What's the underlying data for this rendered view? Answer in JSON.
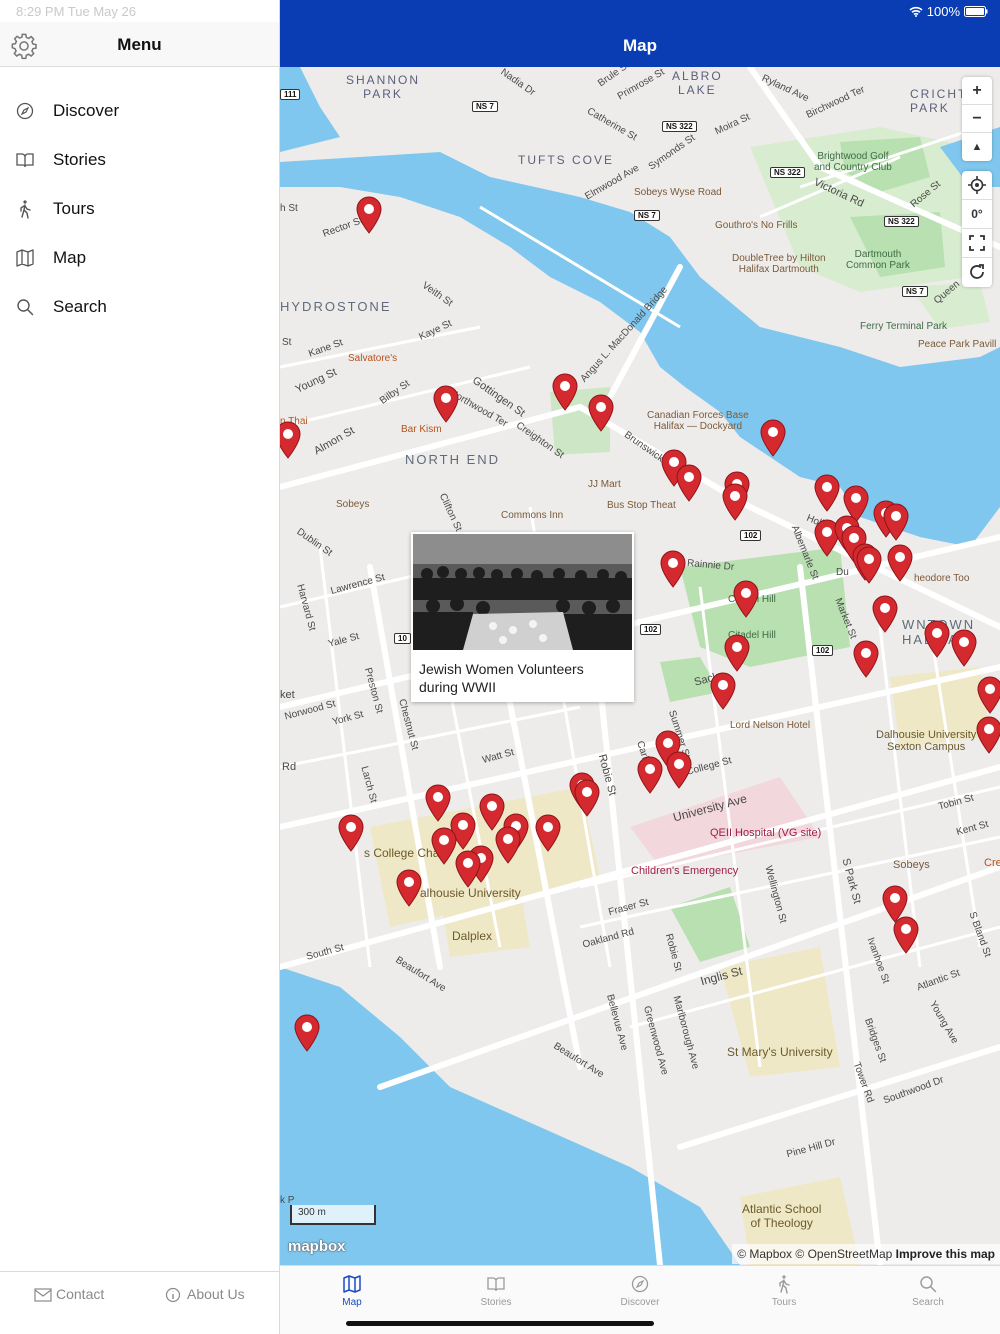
{
  "status": {
    "time": "8:29 PM  Tue May 26",
    "battery": "100%"
  },
  "sidebar": {
    "title": "Menu",
    "items": [
      {
        "label": "Discover",
        "icon": "compass-icon"
      },
      {
        "label": "Stories",
        "icon": "book-icon"
      },
      {
        "label": "Tours",
        "icon": "walking-icon"
      },
      {
        "label": "Map",
        "icon": "map-icon"
      },
      {
        "label": "Search",
        "icon": "search-icon"
      }
    ],
    "footer": {
      "contact": "Contact",
      "about": "About Us"
    }
  },
  "navbar": {
    "title": "Map"
  },
  "map": {
    "popup": {
      "title": "Jewish Women Volunteers during WWII"
    },
    "scale": "300 m",
    "logo": "mapbox",
    "attribution": {
      "mapbox": "© Mapbox",
      "osm": "© OpenStreetMap",
      "improve": "Improve this map"
    },
    "controls": {
      "zoom_in": "+",
      "zoom_out": "−",
      "compass": "▲",
      "bearing": "0°"
    },
    "labels": {
      "shannon_park": "SHANNON\nPARK",
      "albro_lake": "ALBRO\nLAKE",
      "crichton_park": "CRICHT\nPARK",
      "tufts_cove": "TUFTS COVE",
      "hydrostone": "HYDROSTONE",
      "north_end": "NORTH END",
      "downtown_halifax": "WNTOWN\nHALIFAX",
      "brightwood": "Brightwood Golf\nand Country Club",
      "dartmouth_common": "Dartmouth\nCommon Park",
      "sobeys_wyse": "Sobeys Wyse Road",
      "gouthros": "Gouthro's No Frills",
      "doubletree": "DoubleTree by Hilton\nHalifax Dartmouth",
      "ferry_terminal": "Ferry Terminal Park",
      "peace_park": "Peace Park Pavill",
      "cfb": "Canadian Forces Base\nHalifax — Dockyard",
      "salvatores": "Salvatore's",
      "bar_kismet": "Bar Kism",
      "n_thai": "n Thai",
      "jj_mart": "JJ Mart",
      "bus_stop": "Bus Stop Theat",
      "commons_inn": "Commons Inn",
      "sobeys_north": "Sobeys",
      "citadel1": "Citadel Hill",
      "citadel2": "Citadel Hill",
      "theodore": "heodore Too",
      "lord_nelson": "Lord Nelson Hotel",
      "dal_sexton": "Dalhousie University\nSexton Campus",
      "qeii": "QEII Hospital (VG site)",
      "childrens": "Children's Emergency",
      "kings": "s College Cha",
      "dalhousie": "alhousie University",
      "dalplex": "Dalplex",
      "sobeys_south": "Sobeys",
      "st_marys": "St Mary's University",
      "atlantic_school": "Atlantic School\nof Theology",
      "ket": "ket",
      "rd": "Rd",
      "cre": "Cre"
    },
    "streets": {
      "nadia": "Nadia Dr",
      "brule": "Brule St",
      "primrose": "Primrose St",
      "catherine": "Catherine St",
      "ryland": "Ryland Ave",
      "birchwood": "Birchwood Ter",
      "moira": "Moira St",
      "symonds": "Symonds St",
      "elmwood": "Elmwood Ave",
      "victoria": "Victoria Rd",
      "rose": "Rose St",
      "queen": "Queen",
      "rector": "Rector St",
      "veith": "Veith St",
      "kaye": "Kaye St",
      "kane": "Kane St",
      "young": "Young St",
      "bilby": "Bilby St",
      "gottingen": "Gottingen St",
      "northwood": "Northwood Ter",
      "creighton": "Creighton St",
      "almon": "Almon St",
      "angus": "Angus L. MacDonald Bridge",
      "brunswick": "Brunswick St",
      "clifton": "Clifton St",
      "dublin": "Dublin St",
      "lawrence": "Lawrence St",
      "harvard": "Harvard St",
      "yale": "Yale St",
      "preston": "Preston St",
      "chestnut": "Chestnut St",
      "norwood": "Norwood St",
      "york": "York St",
      "larch": "Larch St",
      "watt": "Watt St",
      "robie": "Robie St",
      "robie2": "Robie St",
      "summer": "Summer St",
      "carlton": "Carlton St",
      "college": "College St",
      "university": "University Ave",
      "sackville": "Sackv",
      "rainnie": "Rainnie Dr",
      "albemarle": "Albemarle St",
      "market": "Market St",
      "hollis": "Hollis",
      "duke": "Du",
      "tobin": "Tobin St",
      "kent": "Kent St",
      "s_park": "S Park St",
      "wellington": "Wellington St",
      "fraser": "Fraser St",
      "oakland": "Oakland Rd",
      "south": "South St",
      "beaufort": "Beaufort Ave",
      "beaufort2": "Beaufort Ave",
      "bellevue": "Bellevue Ave",
      "greenwood": "Greenwood Ave",
      "marlborough": "Marlborough Ave",
      "inglis": "Inglis St",
      "ivanhoe": "Ivanhoe St",
      "bridges": "Bridges St",
      "tower": "Tower Rd",
      "atlantic": "Atlantic St",
      "young_ave": "Young Ave",
      "southwood": "Southwood Dr",
      "pine_hill": "Pine Hill Dr",
      "s_bland": "S Bland St",
      "st_short": "St",
      "sth": "h St",
      "kp": "k P"
    },
    "shields": {
      "ns111": "111",
      "ns7a": "NS 7",
      "ns322a": "NS 322",
      "ns322b": "NS 322",
      "ns322c": "NS 322",
      "ns7b": "NS 7",
      "ns7c": "NS 7",
      "r102a": "102",
      "r102b": "102",
      "r102c": "102",
      "r102d": "10"
    }
  },
  "tabbar": {
    "tabs": [
      {
        "label": "Map",
        "active": true
      },
      {
        "label": "Stories",
        "active": false
      },
      {
        "label": "Discover",
        "active": false
      },
      {
        "label": "Tours",
        "active": false
      },
      {
        "label": "Search",
        "active": false
      }
    ]
  },
  "colors": {
    "nav_blue": "#0a3db3",
    "pin_red": "#d42a2f",
    "water": "#7fc7ee",
    "park": "#b8e0b0",
    "tab_active": "#1a4bc4"
  }
}
